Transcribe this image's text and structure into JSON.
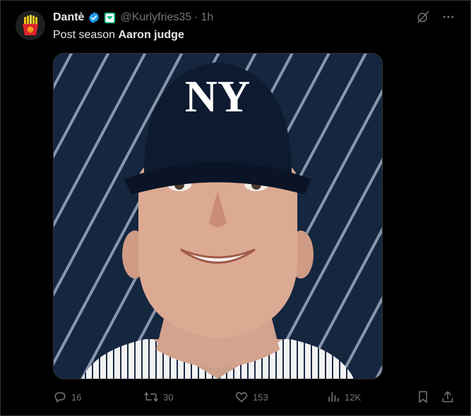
{
  "tweet": {
    "display_name": "Dantè",
    "handle": "@Kurlyfries35",
    "separator": "·",
    "time": "1h",
    "text_plain": "Post season ",
    "text_bold": "Aaron judge"
  },
  "media": {
    "cap_logo": "NY"
  },
  "actions": {
    "replies": "16",
    "reposts": "30",
    "likes": "153",
    "views": "12K"
  },
  "colors": {
    "background": "#000000",
    "text_primary": "#e7e9ea",
    "text_secondary": "#71767b",
    "verified_blue": "#1d9bf0",
    "affiliate_badge": "#00ba7c",
    "media_navy": "#15263f"
  },
  "icons": [
    "fries-avatar",
    "verified-badge-icon",
    "affiliate-badge-icon",
    "grok-icon",
    "more-icon",
    "reply-icon",
    "repost-icon",
    "like-icon",
    "views-icon",
    "bookmark-icon",
    "share-icon"
  ]
}
